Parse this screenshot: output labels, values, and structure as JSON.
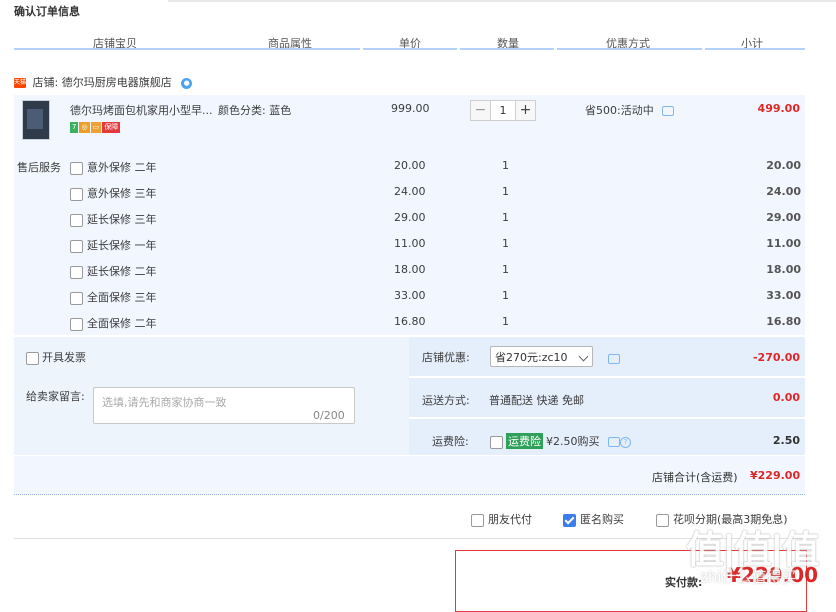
{
  "page_title": "确认订单信息",
  "columns": [
    "店铺宝贝",
    "商品属性",
    "单价",
    "数量",
    "优惠方式",
    "小计"
  ],
  "shop": {
    "badge": "天猫",
    "label": "店铺:",
    "name": "德尔玛厨房电器旗舰店"
  },
  "product": {
    "name": "德尔玛烤面包机家用小型早...",
    "attribute": "颜色分类: 蓝色",
    "unit_price": "999.00",
    "quantity": "1",
    "promo": "省500:活动中",
    "subtotal": "499.00",
    "badges": [
      "7",
      "◎",
      "▭",
      "保障"
    ]
  },
  "after_sale": {
    "label": "售后服务",
    "items": [
      {
        "name": "意外保修 二年",
        "price": "20.00",
        "qty": "1",
        "subtotal": "20.00"
      },
      {
        "name": "意外保修 三年",
        "price": "24.00",
        "qty": "1",
        "subtotal": "24.00"
      },
      {
        "name": "延长保修 三年",
        "price": "29.00",
        "qty": "1",
        "subtotal": "29.00"
      },
      {
        "name": "延长保修 一年",
        "price": "11.00",
        "qty": "1",
        "subtotal": "11.00"
      },
      {
        "name": "延长保修 二年",
        "price": "18.00",
        "qty": "1",
        "subtotal": "18.00"
      },
      {
        "name": "全面保修 三年",
        "price": "33.00",
        "qty": "1",
        "subtotal": "33.00"
      },
      {
        "name": "全面保修 二年",
        "price": "16.80",
        "qty": "1",
        "subtotal": "16.80"
      }
    ]
  },
  "invoice_label": "开具发票",
  "message": {
    "label": "给卖家留言:",
    "placeholder": "选填,请先和商家协商一致",
    "counter": "0/200"
  },
  "shop_discount": {
    "label": "店铺优惠:",
    "selected": "省270元:zc10",
    "value": "-270.00"
  },
  "shipping": {
    "label": "运送方式:",
    "method": "普通配送 快递 免邮",
    "value": "0.00"
  },
  "insurance": {
    "label": "运费险:",
    "tag": "运费险",
    "price_text": "¥2.50购买",
    "value": "2.50"
  },
  "shop_total": {
    "label": "店铺合计(含运费)",
    "value": "¥229.00"
  },
  "options": [
    {
      "label": "朋友代付",
      "checked": false
    },
    {
      "label": "匿名购买",
      "checked": true
    },
    {
      "label": "花呗分期(最高3期免息)",
      "checked": false
    }
  ],
  "pay": {
    "label": "实付款:",
    "value": "¥229.00"
  },
  "watermark": {
    "big": "值|值|值",
    "small": "zhi什么值得买"
  }
}
